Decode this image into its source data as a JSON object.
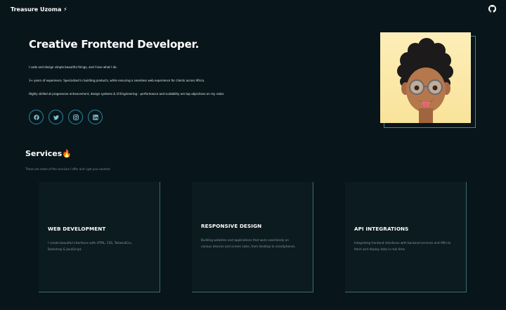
{
  "nav": {
    "brand": "Treasure Uzoma ⚡",
    "github_icon": "github-icon"
  },
  "hero": {
    "title": "Creative Frontend Developer.",
    "paragraphs": [
      "I code and design simple beautiful things, and I love what I do.",
      "3+ years of experience. Specialized in building products, while ensuring a seamless web experience for clients across Africa.",
      "Highly skilled at progressive enhancement, design systems & UI Engineering – performance and scalability are top objectives on my radar."
    ],
    "socials": [
      "facebook-icon",
      "twitter-icon",
      "instagram-icon",
      "linkedin-icon"
    ]
  },
  "services": {
    "title": "Services🔥",
    "subtitle": "These are some of the services I offer and I got you covered",
    "items": [
      {
        "title": "WEB DEVELOPMENT",
        "desc": "I create beautiful interfaces with HTML, CSS, TailwindCss, Bootstrap & JavaScript."
      },
      {
        "title": "RESPONSIVE DESIGN",
        "desc": "Building websites and applications that work seamlessly on various devices and screen sizes, from desktop to smartphones."
      },
      {
        "title": "API INTEGRATIONS",
        "desc": "Integrating frontend interfaces with backend services and APIs to fetch and display data in real time"
      }
    ]
  },
  "colors": {
    "background": "#08151a",
    "accent": "#2a8aa0",
    "avatar_bg": "#fbe6a3"
  }
}
